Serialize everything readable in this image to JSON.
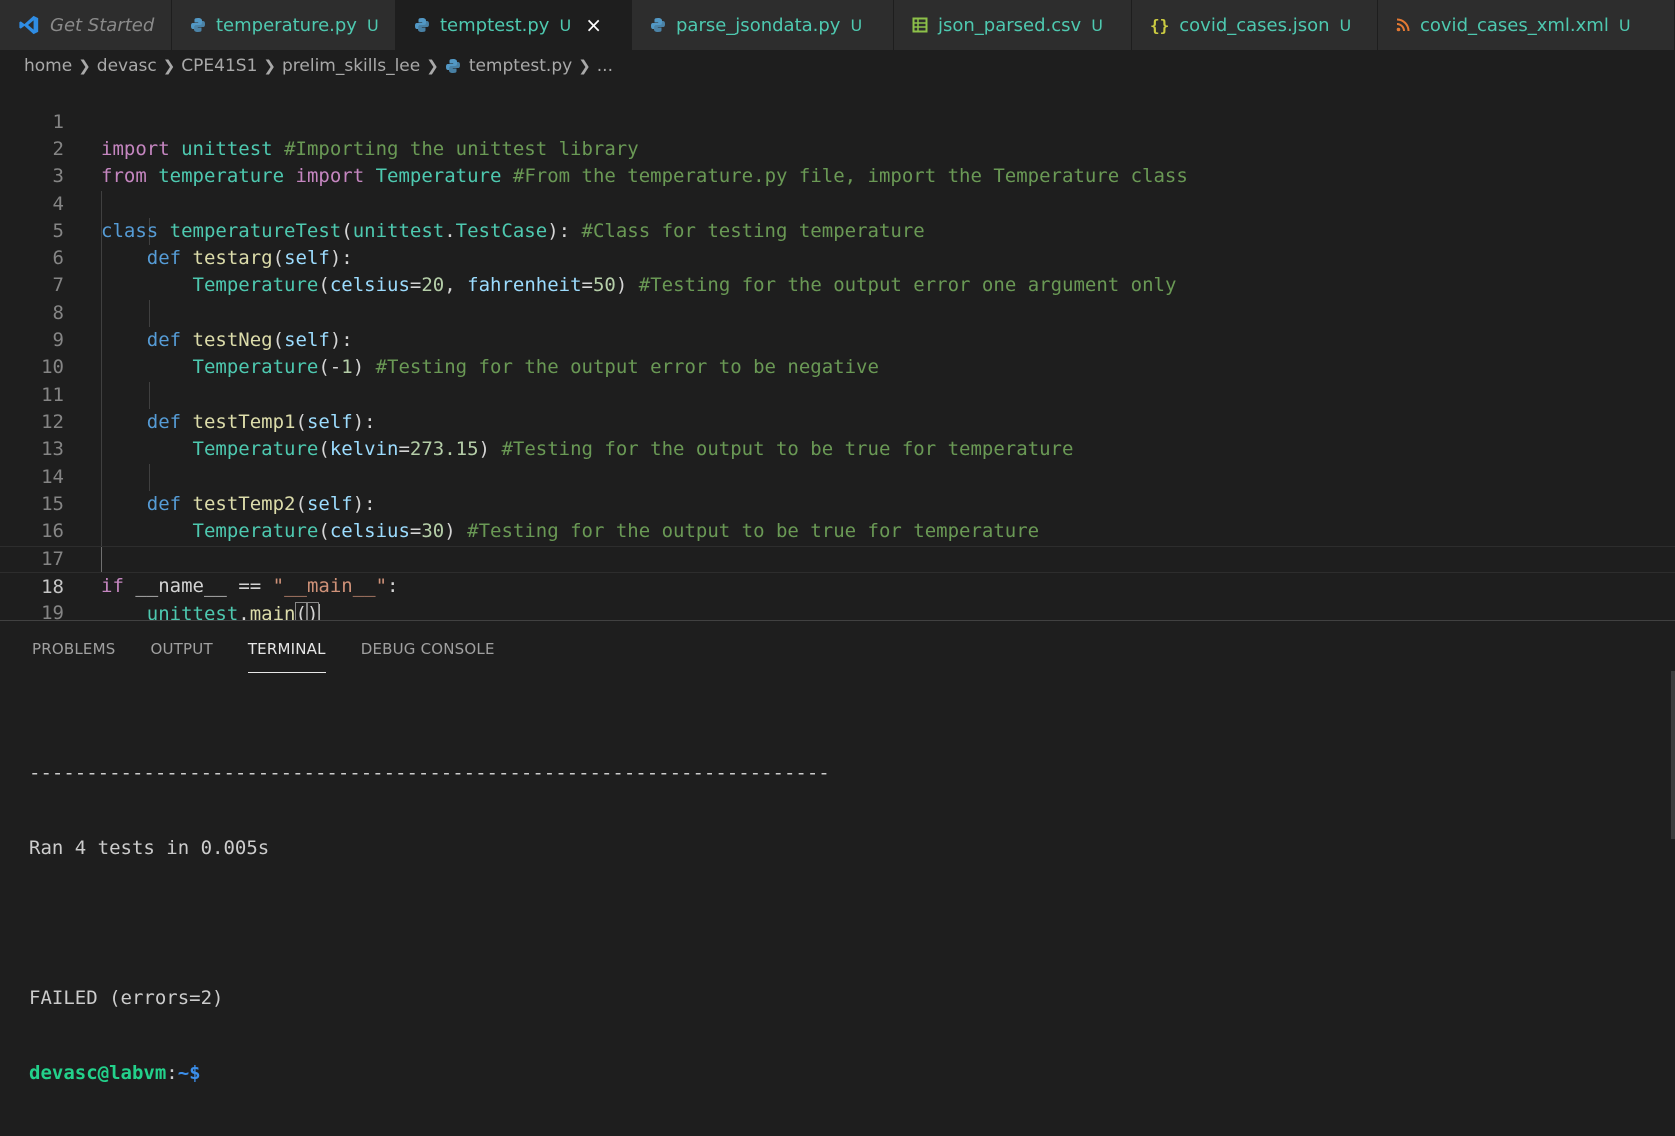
{
  "tabs": [
    {
      "label": "Get Started",
      "icon": "vscode-logo-icon",
      "badge": "",
      "active": false
    },
    {
      "label": "temperature.py",
      "icon": "python-icon",
      "badge": "U",
      "active": false
    },
    {
      "label": "temptest.py",
      "icon": "python-icon",
      "badge": "U",
      "active": true,
      "close": "×"
    },
    {
      "label": "parse_jsondata.py",
      "icon": "python-icon",
      "badge": "U",
      "active": false
    },
    {
      "label": "json_parsed.csv",
      "icon": "csv-table-icon",
      "badge": "U",
      "active": false
    },
    {
      "label": "covid_cases.json",
      "icon": "json-braces-icon",
      "badge": "U",
      "active": false
    },
    {
      "label": "covid_cases_xml.xml",
      "icon": "rss-icon",
      "badge": "U",
      "active": false
    }
  ],
  "breadcrumb": [
    "home",
    "devasc",
    "CPE41S1",
    "prelim_skills_lee",
    "temptest.py",
    "..."
  ],
  "editor": {
    "line_numbers": [
      "1",
      "2",
      "3",
      "4",
      "5",
      "6",
      "7",
      "8",
      "9",
      "10",
      "11",
      "12",
      "13",
      "14",
      "15",
      "16",
      "17",
      "18",
      "19"
    ],
    "current_line": "18"
  },
  "panel": {
    "tabs": [
      "PROBLEMS",
      "OUTPUT",
      "TERMINAL",
      "DEBUG CONSOLE"
    ],
    "active_tab": "TERMINAL"
  },
  "terminal": {
    "separator": "----------------------------------------------------------------------",
    "ran": "Ran 4 tests in 0.005s",
    "result": "FAILED (errors=2)",
    "prompt_user": "devasc@labvm",
    "prompt_sep": ":",
    "prompt_path": "~$"
  }
}
